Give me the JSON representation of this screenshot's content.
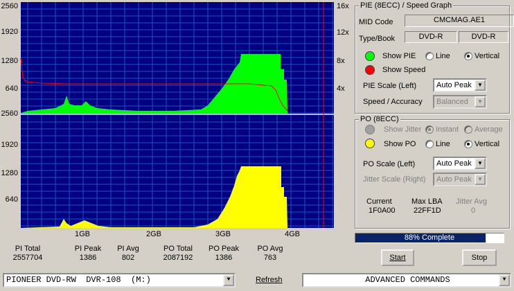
{
  "colors": {
    "plot_bg": "#000080",
    "grid": "#1e50c8",
    "pie": "#00ff00",
    "po": "#ffff00",
    "speed": "#ff0000",
    "separator": "#aab4ff",
    "progress": "#0a246a"
  },
  "graph": {
    "y_left_top": [
      "2560",
      "1920",
      "1280",
      "640"
    ],
    "y_left_bottom": [
      "2560",
      "1920",
      "1280",
      "640"
    ],
    "y_right": [
      "16x",
      "12x",
      "8x",
      "4x"
    ],
    "x_labels": [
      "1GB",
      "2GB",
      "3GB",
      "4GB"
    ]
  },
  "stats": [
    {
      "label": "PI Total",
      "value": "2557704"
    },
    {
      "label": "PI Peak",
      "value": "1386"
    },
    {
      "label": "PI Avg",
      "value": "802"
    },
    {
      "label": "PO Total",
      "value": "2087192"
    },
    {
      "label": "PO Peak",
      "value": "1386"
    },
    {
      "label": "PO Avg",
      "value": "763"
    }
  ],
  "pie_panel": {
    "title": "PIE (8ECC) / Speed Graph",
    "mid_label": "MID Code",
    "mid_value": "CMCMAG.AE1",
    "type_label": "Type/Book",
    "type_value": "DVD-R",
    "book_value": "DVD-R",
    "show_pie": "Show PIE",
    "show_speed": "Show Speed",
    "line": "Line",
    "vertical": "Vertical",
    "scale_label": "PIE Scale (Left)",
    "scale_value": "Auto Peak",
    "accuracy_label": "Speed / Accuracy",
    "accuracy_value": "Balanced"
  },
  "po_panel": {
    "title": "PO (8ECC)",
    "show_jitter": "Show Jitter",
    "instant": "Instant",
    "average": "Average",
    "show_po": "Show PO",
    "line": "Line",
    "vertical": "Vertical",
    "scale_label": "PO Scale (Left)",
    "scale_value": "Auto Peak",
    "jitter_scale_label": "Jitter Scale (Right)",
    "jitter_scale_value": "Auto Peak",
    "current_label": "Current",
    "current_value": "1F0A00",
    "maxlba_label": "Max LBA",
    "maxlba_value": "22FF1D",
    "jitter_avg_label": "Jitter Avg",
    "jitter_avg_value": "0"
  },
  "progress": {
    "text": "88% Complete",
    "fraction": 0.88
  },
  "buttons": {
    "start": "Start",
    "stop": "Stop"
  },
  "bottom": {
    "drive": "PIONEER DVD-RW  DVR-108  (M:)",
    "refresh": "Refresh",
    "commands": "ADVANCED COMMANDS"
  }
}
